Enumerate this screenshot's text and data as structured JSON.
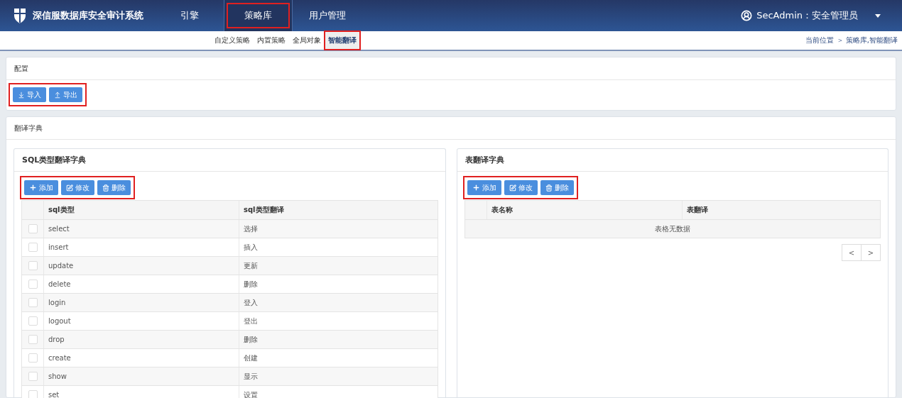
{
  "header": {
    "title": "深信服数据库安全审计系统",
    "nav": [
      {
        "label": "引擎",
        "selected": false,
        "highlighted": false
      },
      {
        "label": "策略库",
        "selected": true,
        "highlighted": true
      },
      {
        "label": "用户管理",
        "selected": false,
        "highlighted": false
      }
    ],
    "user": "SecAdmin：安全管理员"
  },
  "subnav": {
    "tabs": [
      {
        "label": "自定义策略",
        "selected": false,
        "highlighted": false
      },
      {
        "label": "内置策略",
        "selected": false,
        "highlighted": false
      },
      {
        "label": "全局对象",
        "selected": false,
        "highlighted": false
      },
      {
        "label": "智能翻译",
        "selected": true,
        "highlighted": true
      }
    ],
    "breadcrumb": "当前位置 ＞ 策略库,智能翻译"
  },
  "config": {
    "title": "配置",
    "highlighted": true,
    "buttons": [
      {
        "kind": "import",
        "label": "导入"
      },
      {
        "kind": "export",
        "label": "导出"
      }
    ]
  },
  "dictionary": {
    "title": "翻译字典",
    "panels": [
      {
        "title": "SQL类型翻译字典",
        "highlighted": true,
        "buttons": [
          {
            "kind": "add",
            "label": "添加"
          },
          {
            "kind": "edit",
            "label": "修改"
          },
          {
            "kind": "delete",
            "label": "删除"
          }
        ],
        "columns": [
          "sql类型",
          "sql类型翻译"
        ],
        "rows": [
          {
            "cells": [
              "select",
              "选择"
            ],
            "checked": false
          },
          {
            "cells": [
              "insert",
              "插入"
            ],
            "checked": false
          },
          {
            "cells": [
              "update",
              "更新"
            ],
            "checked": false
          },
          {
            "cells": [
              "delete",
              "删除"
            ],
            "checked": false
          },
          {
            "cells": [
              "login",
              "登入"
            ],
            "checked": false
          },
          {
            "cells": [
              "logout",
              "登出"
            ],
            "checked": false
          },
          {
            "cells": [
              "drop",
              "删除"
            ],
            "checked": false
          },
          {
            "cells": [
              "create",
              "创建"
            ],
            "checked": false
          },
          {
            "cells": [
              "show",
              "显示"
            ],
            "checked": false
          },
          {
            "cells": [
              "set",
              "设置"
            ],
            "checked": false
          }
        ]
      },
      {
        "title": "表翻译字典",
        "highlighted": true,
        "buttons": [
          {
            "kind": "add",
            "label": "添加"
          },
          {
            "kind": "edit",
            "label": "修改"
          },
          {
            "kind": "delete",
            "label": "删除"
          }
        ],
        "columns": [
          "表名称",
          "表翻译"
        ],
        "empty": "表格无数据",
        "pager": [
          "<",
          ">"
        ]
      }
    ]
  }
}
